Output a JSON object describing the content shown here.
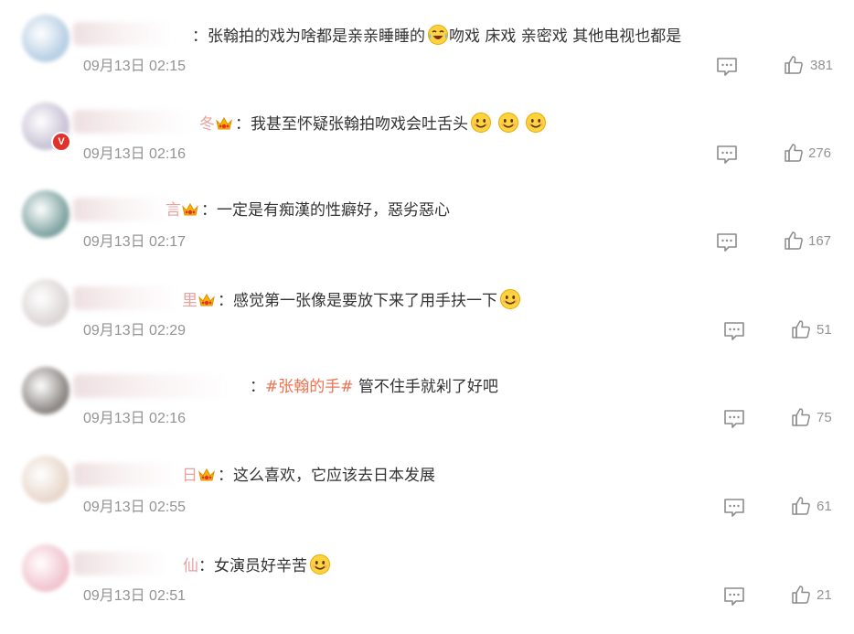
{
  "comments": [
    {
      "avatar_color": "#b8cfe4",
      "name_hint": "",
      "has_crown": false,
      "has_v_badge": false,
      "separator": "：",
      "topic": "",
      "text": "张翰拍的戏为啥都是亲亲睡睡的",
      "emoji": "laugh-tears-icon",
      "text_after": "吻戏 床戏 亲密戏 其他电视也都是",
      "trailing_emojis": 0,
      "time": "09月13日 02:15",
      "likes": "381"
    },
    {
      "avatar_color": "#c9c3d6",
      "name_hint": "冬",
      "has_crown": true,
      "has_v_badge": true,
      "separator": "：",
      "topic": "",
      "text": "我甚至怀疑张翰拍吻戏会吐舌头",
      "emoji": "",
      "text_after": "",
      "trailing_emojis": 3,
      "time": "09月13日 02:16",
      "likes": "276"
    },
    {
      "avatar_color": "#7fa4a2",
      "name_hint": "言",
      "has_crown": true,
      "has_v_badge": false,
      "separator": "：",
      "topic": "",
      "text": "一定是有痴漢的性癖好，惡劣惡心",
      "emoji": "",
      "text_after": "",
      "trailing_emojis": 0,
      "time": "09月13日 02:17",
      "likes": "167"
    },
    {
      "avatar_color": "#ddd6d6",
      "name_hint": "里",
      "has_crown": true,
      "has_v_badge": false,
      "separator": "：",
      "topic": "",
      "text": "感觉第一张像是要放下来了用手扶一下",
      "emoji": "",
      "text_after": "",
      "trailing_emojis": 1,
      "time": "09月13日 02:29",
      "likes": "51"
    },
    {
      "avatar_color": "#8d8784",
      "name_hint": "",
      "has_crown": false,
      "has_v_badge": false,
      "separator": "：",
      "topic": "#张翰的手#",
      "text": "管不住手就剁了好吧",
      "emoji": "",
      "text_after": "",
      "trailing_emojis": 0,
      "time": "09月13日 02:16",
      "likes": "75"
    },
    {
      "avatar_color": "#e8d8cc",
      "name_hint": "日",
      "has_crown": true,
      "has_v_badge": false,
      "separator": "：",
      "topic": "",
      "text": "这么喜欢，它应该去日本发展",
      "emoji": "",
      "text_after": "",
      "trailing_emojis": 0,
      "time": "09月13日 02:55",
      "likes": "61"
    },
    {
      "avatar_color": "#f1c4cf",
      "name_hint": "仙",
      "has_crown": false,
      "has_v_badge": false,
      "separator": "：",
      "topic": "",
      "text": "女演员好辛苦",
      "emoji": "",
      "text_after": "",
      "trailing_emojis": 1,
      "time": "09月13日 02:51",
      "likes": "21"
    }
  ],
  "icons": {
    "reply": "comment-icon",
    "like": "thumbs-up-icon",
    "emoji": "smile-emoji-icon",
    "crown": "crown-badge-icon"
  },
  "colors": {
    "text": "#333333",
    "meta": "#939393",
    "topic": "#eb7350",
    "badge": "#e0312a"
  }
}
